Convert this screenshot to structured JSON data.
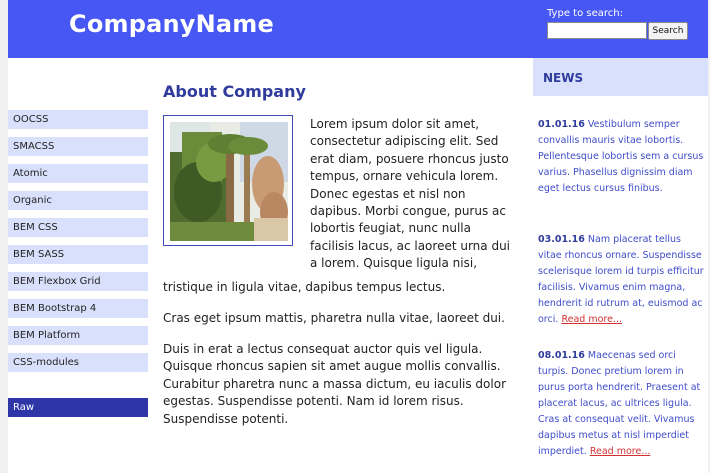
{
  "header": {
    "brand": "CompanyName",
    "search_label": "Type to search:",
    "search_value": "",
    "search_button": "Search"
  },
  "sidebar": {
    "items": [
      {
        "label": "OOCSS"
      },
      {
        "label": "SMACSS"
      },
      {
        "label": "Atomic"
      },
      {
        "label": "Organic"
      },
      {
        "label": "BEM CSS"
      },
      {
        "label": "BEM SASS"
      },
      {
        "label": "BEM Flexbox Grid"
      },
      {
        "label": "BEM Bootstrap 4"
      },
      {
        "label": "BEM Platform"
      },
      {
        "label": "CSS-modules"
      },
      {
        "label": "Raw"
      }
    ],
    "active_item": "Raw"
  },
  "main": {
    "title": "About Company",
    "p1": "Lorem ipsum dolor sit amet, consectetur adipiscing elit. Sed erat diam, posuere rhoncus justo tempus, ornare vehicula lorem. Donec egestas et nisl non dapibus. Morbi congue, purus ac lobortis feugiat, nunc nulla facilisis lacus, ac laoreet urna dui a lorem. Quisque ligula nisi,",
    "p1_tail": "tristique in ligula vitae, dapibus tempus lectus.",
    "p2": "Cras eget ipsum mattis, pharetra nulla vitae, laoreet dui.",
    "p3": "Duis in erat a lectus consequat auctor quis vel ligula. Quisque rhoncus sapien sit amet augue mollis convallis. Curabitur pharetra nunc a massa dictum, eu iaculis dolor egestas. Suspendisse potenti. Nam id lorem risus. Suspendisse potenti."
  },
  "news": {
    "title": "NEWS",
    "items": [
      {
        "date": "01.01.16",
        "text": "Vestibulum semper convallis mauris vitae lobortis. Pellentesque lobortis sem a cursus varius. Phasellus dignissim diam eget lectus cursus finibus.",
        "read_more": ""
      },
      {
        "date": "03.01.16",
        "text": "Nam placerat tellus vitae rhoncus ornare. Suspendisse scelerisque lorem id turpis efficitur facilisis. Vivamus enim magna, hendrerit id rutrum at, euismod ac orci.",
        "read_more": "Read more..."
      },
      {
        "date": "08.01.16",
        "text": "Maecenas sed orci turpis. Donec pretium lorem in purus porta hendrerit. Praesent at placerat lacus, ac ultrices ligula. Cras at consequat velit. Vivamus dapibus metus at nisl imperdiet imperdiet.",
        "read_more": "Read more..."
      }
    ]
  },
  "colors": {
    "header_bg": "#4757f3",
    "sidebar_item_bg": "#d9e0fb",
    "sidebar_active_bg": "#2e36a7",
    "title_color": "#2f3b9d",
    "news_text": "#3f4cc9",
    "read_more": "#d23131"
  }
}
